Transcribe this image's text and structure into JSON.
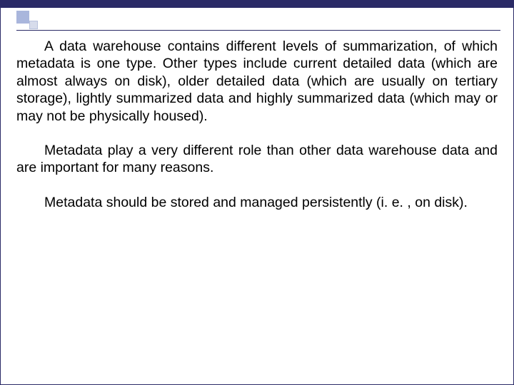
{
  "paragraphs": {
    "p1": "A data warehouse contains different levels of summarization, of which metadata is one type. Other types include current detailed data (which are almost always on disk), older detailed data (which are usually on tertiary storage), lightly summarized data and highly summarized data (which may or may not be physically housed).",
    "p2": "Metadata play a very different role than other data warehouse data and are important for many reasons.",
    "p3": "Metadata should be stored and managed persistently (i. e. , on disk)."
  }
}
